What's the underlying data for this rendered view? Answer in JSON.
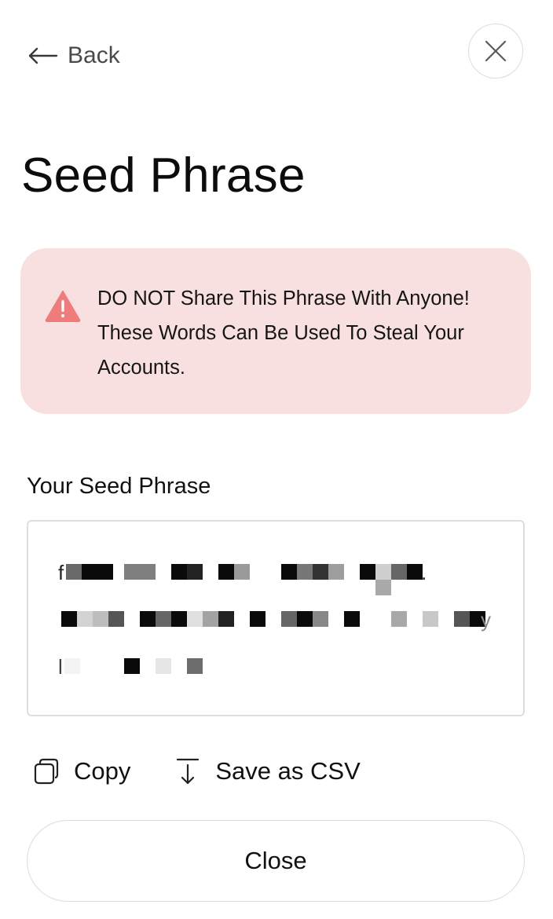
{
  "nav": {
    "back_label": "Back",
    "back_icon": "arrow-left-icon",
    "close_icon": "close-icon"
  },
  "page": {
    "title": "Seed Phrase"
  },
  "warning": {
    "icon": "warning-triangle-icon",
    "line1": "DO NOT Share This Phrase With Anyone!",
    "line2": "These Words Can Be Used To Steal Your",
    "line3": "Accounts.",
    "background": "#f9e0e0",
    "icon_color": "#f07b7b"
  },
  "seed": {
    "label": "Your Seed Phrase",
    "redacted": true,
    "visible_glyphs": [
      "f",
      ".",
      "y",
      "l"
    ]
  },
  "actions": {
    "copy_label": "Copy",
    "copy_icon": "copy-icon",
    "save_label": "Save as CSV",
    "save_icon": "download-arrow-icon"
  },
  "footer": {
    "close_label": "Close"
  }
}
